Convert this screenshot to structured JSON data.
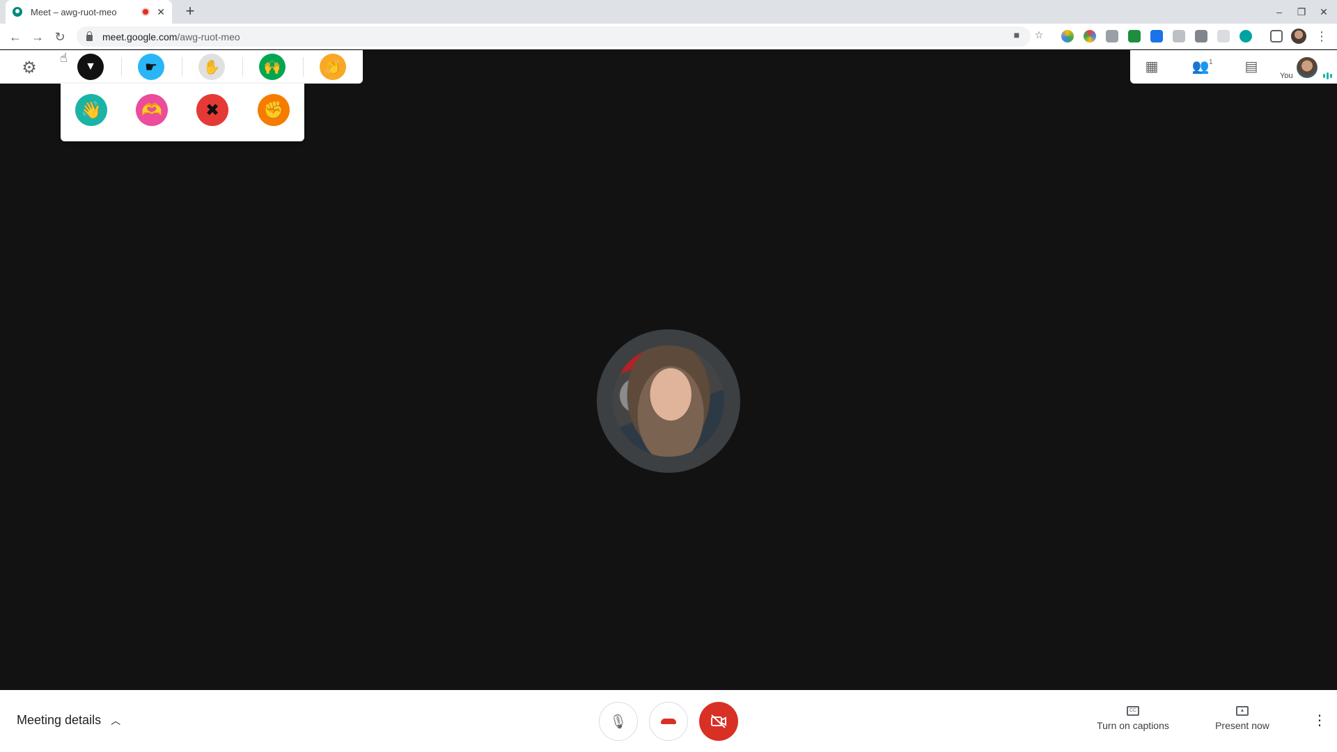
{
  "browser": {
    "tab_title": "Meet – awg-ruot-meo",
    "new_tab": "+",
    "url_host": "meet.google.com",
    "url_path": "/awg-ruot-meo",
    "window": {
      "minimize": "–",
      "restore": "❐",
      "close": "✕"
    }
  },
  "gestures": {
    "row": [
      {
        "name": "collapse",
        "color": "#111111"
      },
      {
        "name": "point",
        "color": "#29b6f6"
      },
      {
        "name": "raise-hand",
        "color": "#e0e0e0"
      },
      {
        "name": "both-hands",
        "color": "#00a651"
      },
      {
        "name": "applause",
        "color": "#f9a825"
      }
    ],
    "panel": [
      {
        "name": "wave",
        "color": "#1bb3a6"
      },
      {
        "name": "heart-hands",
        "color": "#ec4c9b"
      },
      {
        "name": "cross-arms",
        "color": "#e53935"
      },
      {
        "name": "fist",
        "color": "#f57c00"
      }
    ]
  },
  "topright": {
    "participants_count": "1",
    "you_label": "You"
  },
  "bottombar": {
    "meeting_details": "Meeting details",
    "captions_label": "Turn on captions",
    "captions_icon": "CC",
    "present_label": "Present now"
  },
  "colors": {
    "hangup_red": "#d93025",
    "cam_off_red": "#d93025",
    "stage_bg": "#121212",
    "speaking_teal": "#1fb5a8"
  }
}
